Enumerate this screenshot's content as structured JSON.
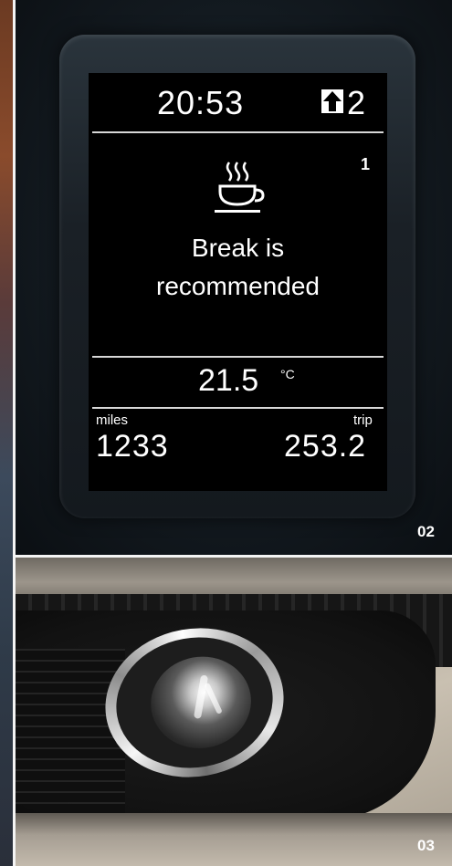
{
  "dash": {
    "time": "20:53",
    "gear": "2",
    "corner_number": "1",
    "message_line1": "Break is",
    "message_line2": "recommended",
    "temperature": "21.5",
    "temperature_unit": "°C",
    "left_label": "miles",
    "right_label": "trip",
    "left_value": "1233",
    "right_value": "253.2",
    "icon": "coffee-cup-icon"
  },
  "badges": {
    "panel_02": "02",
    "panel_03": "03"
  }
}
